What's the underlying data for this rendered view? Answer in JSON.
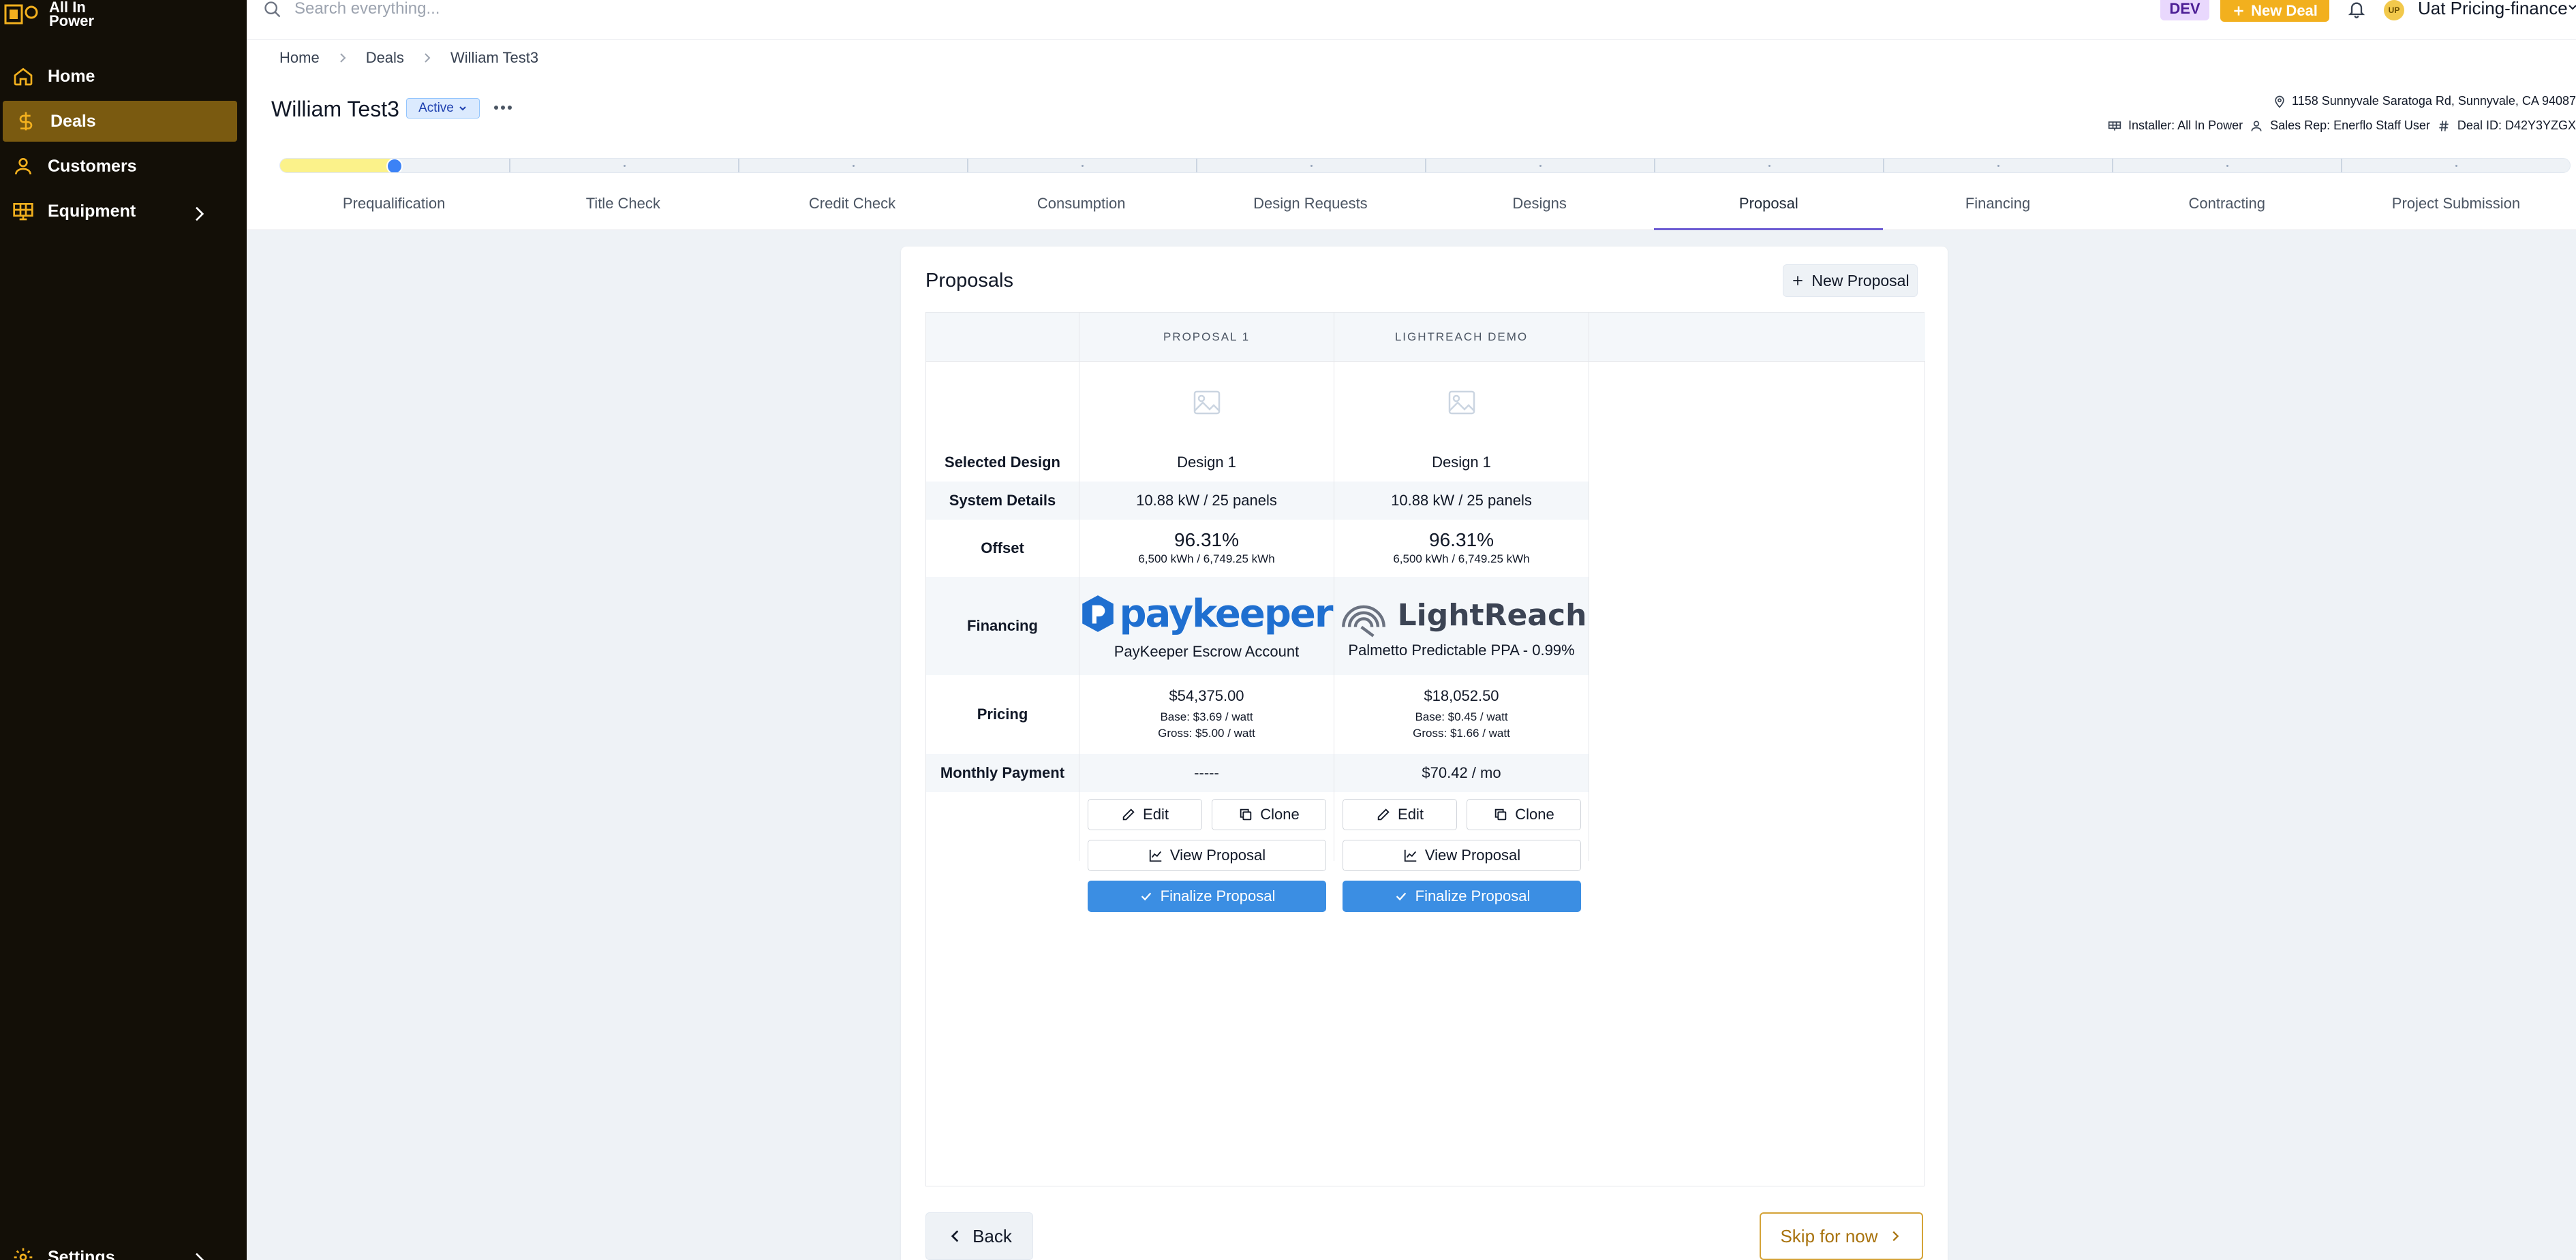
{
  "app": {
    "logo_text": "All In\nPower"
  },
  "sidebar": {
    "items": [
      {
        "label": "Home",
        "icon": "home-icon"
      },
      {
        "label": "Deals",
        "icon": "dollar-icon",
        "active": true
      },
      {
        "label": "Customers",
        "icon": "user-icon"
      },
      {
        "label": "Equipment",
        "icon": "solar-panel-icon"
      }
    ],
    "settings_label": "Settings"
  },
  "topbar": {
    "search_placeholder": "Search everything...",
    "env_badge": "DEV",
    "new_deal_label": "New Deal",
    "user_initials": "UP",
    "user_name": "Uat Pricing-finance"
  },
  "breadcrumb": [
    "Home",
    "Deals",
    "William Test3"
  ],
  "deal": {
    "title": "William Test3",
    "status": "Active",
    "address": "1158 Sunnyvale Saratoga Rd, Sunnyvale, CA 94087",
    "installer": "Installer: All In Power",
    "sales_rep": "Sales Rep: Enerflo Staff User",
    "deal_id": "Deal ID: D42Y3YZGX"
  },
  "progress": {
    "fraction": 0.05
  },
  "steps": [
    "Prequalification",
    "Title Check",
    "Credit Check",
    "Consumption",
    "Design Requests",
    "Designs",
    "Proposal",
    "Financing",
    "Contracting",
    "Project Submission"
  ],
  "active_step": "Proposal",
  "proposals_panel": {
    "title": "Proposals",
    "new_proposal_label": "New Proposal",
    "row_labels": {
      "selected_design": "Selected Design",
      "system_details": "System Details",
      "offset": "Offset",
      "financing": "Financing",
      "pricing": "Pricing",
      "monthly_payment": "Monthly Payment"
    },
    "proposals": [
      {
        "header": "PROPOSAL 1",
        "design": "Design 1",
        "system": "10.88 kW / 25 panels",
        "offset_pct": "96.31%",
        "offset_detail": "6,500 kWh / 6,749.25 kWh",
        "financing_logo": "paykeeper",
        "financing_name": "PayKeeper Escrow Account",
        "price": "$54,375.00",
        "base": "Base: $3.69 / watt",
        "gross": "Gross: $5.00 / watt",
        "monthly": "-----"
      },
      {
        "header": "LIGHTREACH DEMO",
        "design": "Design 1",
        "system": "10.88 kW / 25 panels",
        "offset_pct": "96.31%",
        "offset_detail": "6,500 kWh / 6,749.25 kWh",
        "financing_logo": "LightReach",
        "financing_name": "Palmetto Predictable PPA - 0.99%",
        "price": "$18,052.50",
        "base": "Base: $0.45 / watt",
        "gross": "Gross: $1.66 / watt",
        "monthly": "$70.42 / mo"
      }
    ],
    "buttons": {
      "edit": "Edit",
      "clone": "Clone",
      "view": "View Proposal",
      "finalize": "Finalize Proposal"
    }
  },
  "footer": {
    "back_label": "Back",
    "skip_label": "Skip for now"
  },
  "colors": {
    "sidebar_bg": "#130f07",
    "accent": "#f2b01e",
    "primary": "#3b8ee3",
    "active_nav": "#7a5a10"
  }
}
